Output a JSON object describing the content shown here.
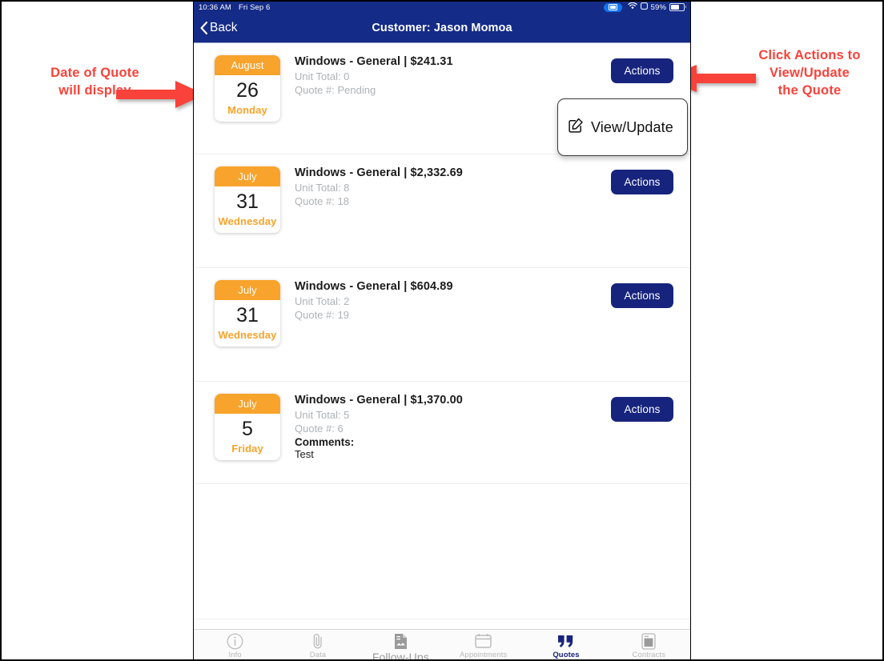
{
  "annotations": {
    "left": "Date of Quote\nwill display",
    "right": "Click Actions to\nView/Update\nthe Quote",
    "color": "#f9423a"
  },
  "status_bar": {
    "time": "10:36 AM",
    "date": "Fri Sep 6",
    "mirror_icon": "screen-mirroring-icon",
    "wifi_icon": "wifi-icon",
    "rotation_icon": "rotation-lock-icon",
    "battery_percent": "59%",
    "battery_level": 59
  },
  "nav": {
    "back_label": "Back",
    "back_icon": "chevron-left-icon",
    "title": "Customer: Jason Momoa",
    "bg_color": "#142b87"
  },
  "quotes": [
    {
      "month": "August",
      "day": "26",
      "weekday": "Monday",
      "title": "Windows - General | $241.31",
      "unit_total": "Unit Total: 0",
      "quote_number": "Quote #: Pending",
      "comments_label": "",
      "comments_text": "",
      "action_label": "Actions"
    },
    {
      "month": "July",
      "day": "31",
      "weekday": "Wednesday",
      "title": "Windows - General | $2,332.69",
      "unit_total": "Unit Total: 8",
      "quote_number": "Quote #: 18",
      "comments_label": "",
      "comments_text": "",
      "action_label": "Actions"
    },
    {
      "month": "July",
      "day": "31",
      "weekday": "Wednesday",
      "title": "Windows - General | $604.89",
      "unit_total": "Unit Total: 2",
      "quote_number": "Quote #: 19",
      "comments_label": "",
      "comments_text": "",
      "action_label": "Actions"
    },
    {
      "month": "July",
      "day": "5",
      "weekday": "Friday",
      "title": "Windows - General | $1,370.00",
      "unit_total": "Unit Total: 5",
      "quote_number": "Quote #: 6",
      "comments_label": "Comments:",
      "comments_text": "Test",
      "action_label": "Actions"
    }
  ],
  "action_menu": {
    "icon": "edit-square-icon",
    "item_label": "View/Update"
  },
  "tabs": [
    {
      "label": "Info",
      "icon": "info-circle-icon",
      "active": false
    },
    {
      "label": "Data",
      "icon": "paperclip-icon",
      "active": false
    },
    {
      "label": "Follow-Ups",
      "icon": "document-icon",
      "active": false
    },
    {
      "label": "Appointments",
      "icon": "calendar-icon",
      "active": false
    },
    {
      "label": "Quotes",
      "icon": "quote-marks-icon",
      "active": true
    },
    {
      "label": "Contracts",
      "icon": "contract-icon",
      "active": false
    }
  ],
  "colors": {
    "navy": "#17247d",
    "header_navy": "#142b87",
    "orange": "#f8a32b",
    "annotation_red": "#f9423a"
  }
}
